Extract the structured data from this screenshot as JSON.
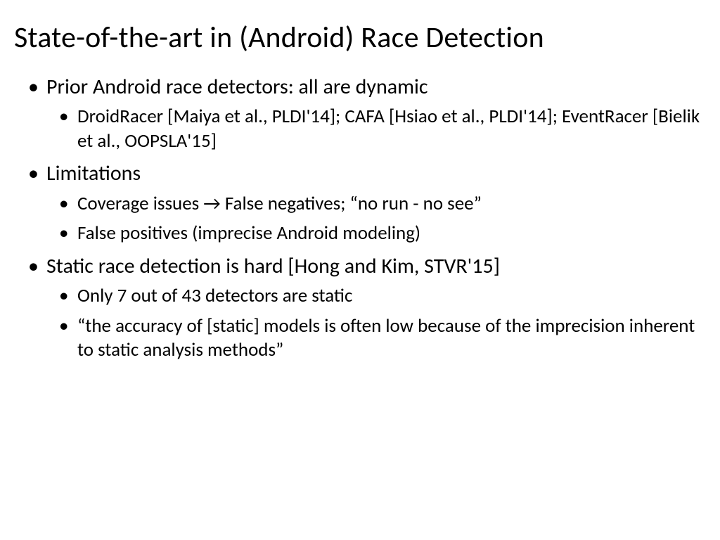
{
  "title": "State-of-the-art in (Android) Race Detection",
  "bullets": {
    "b1": "Prior Android race detectors: all are dynamic",
    "b1_1": "DroidRacer [Maiya et al., PLDI'14]; CAFA [Hsiao et al., PLDI'14]; EventRacer [Bielik et al., OOPSLA'15]",
    "b2": "Limitations",
    "b2_1": "Coverage issues → False negatives; “no run - no see”",
    "b2_2": "False positives (imprecise Android modeling)",
    "b3": "Static race detection is hard [Hong and Kim, STVR'15]",
    "b3_1": "Only 7 out of 43 detectors are static",
    "b3_2": "“the accuracy of [static] models is often low because of the imprecision inherent to static analysis methods”"
  }
}
